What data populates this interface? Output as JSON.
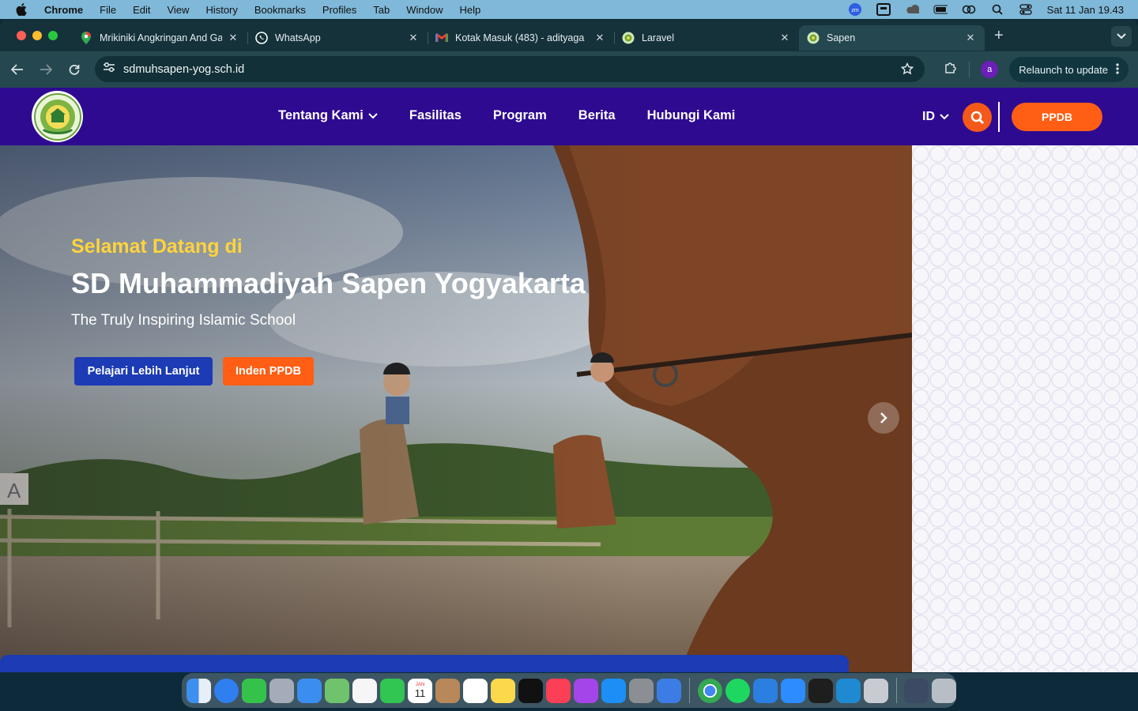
{
  "menubar": {
    "app": "Chrome",
    "items": [
      "File",
      "Edit",
      "View",
      "History",
      "Bookmarks",
      "Profiles",
      "Tab",
      "Window",
      "Help"
    ],
    "clock": "Sat 11 Jan  19.43"
  },
  "tabs": [
    {
      "title": "Mrikiniki Angkringan And Gall",
      "icon": "maps-pin-icon"
    },
    {
      "title": "WhatsApp",
      "icon": "whatsapp-icon"
    },
    {
      "title": "Kotak Masuk (483) - adityaga",
      "icon": "gmail-icon"
    },
    {
      "title": "Laravel",
      "icon": "site-logo-icon"
    },
    {
      "title": "Sapen",
      "icon": "site-logo-icon",
      "active": true
    }
  ],
  "toolbar": {
    "url": "sdmuhsapen-yog.sch.id",
    "profile_initial": "a",
    "relaunch_label": "Relaunch to update"
  },
  "site": {
    "nav": [
      "Tentang Kami",
      "Fasilitas",
      "Program",
      "Berita",
      "Hubungi Kami"
    ],
    "lang": "ID",
    "ppdb_label": "PPDB",
    "hero": {
      "welcome": "Selamat Datang di",
      "title": "SD Muhammadiyah Sapen Yogyakarta",
      "tagline": "The Truly Inspiring Islamic School",
      "learn_more": "Pelajari Lebih Lanjut",
      "inden": "Inden PPDB"
    }
  },
  "colors": {
    "nav_bg": "#2e0a91",
    "accent_orange": "#ff5e14",
    "accent_blue": "#1c3bb4",
    "hero_yellow": "#ffd43b"
  },
  "dock": [
    "finder",
    "safari",
    "messages",
    "launchpad",
    "mail",
    "maps",
    "photos",
    "facetime",
    "calendar",
    "contacts",
    "reminders",
    "notes",
    "tv",
    "music",
    "podcasts",
    "app-store",
    "system-settings",
    "xcode",
    "chrome",
    "spotify",
    "migration",
    "zoom",
    "terminal",
    "vscode",
    "settings",
    "downloads",
    "trash"
  ],
  "calendar_day": "11",
  "calendar_month": "JAN"
}
